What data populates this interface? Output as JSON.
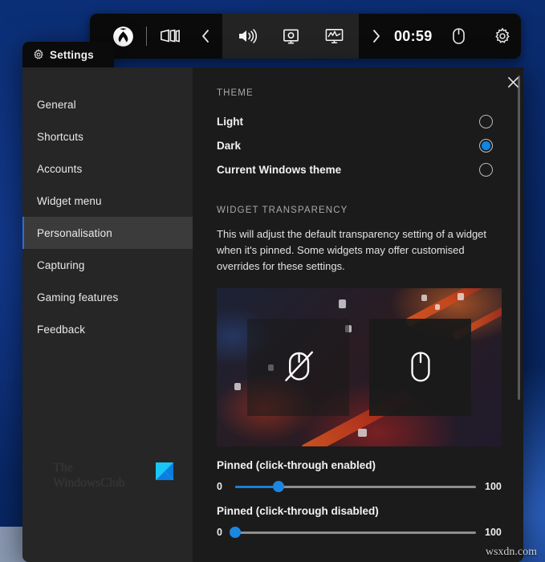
{
  "gamebar": {
    "buttons": [
      {
        "name": "xbox-logo-icon",
        "label": "Xbox"
      },
      {
        "name": "widgets-icon",
        "label": "Widgets"
      },
      {
        "name": "chevron-left-icon",
        "label": "Previous"
      },
      {
        "name": "volume-icon",
        "label": "Audio"
      },
      {
        "name": "capture-icon",
        "label": "Capture"
      },
      {
        "name": "performance-icon",
        "label": "Performance"
      },
      {
        "name": "chevron-right-icon",
        "label": "Next"
      },
      {
        "name": "mouse-icon",
        "label": "Click-through"
      },
      {
        "name": "gear-icon",
        "label": "Settings"
      }
    ],
    "clock": "00:59"
  },
  "window": {
    "title": "Settings",
    "title_icon": "gear-icon",
    "close_label": "Close"
  },
  "sidebar": {
    "items": [
      {
        "label": "General",
        "selected": false
      },
      {
        "label": "Shortcuts",
        "selected": false
      },
      {
        "label": "Accounts",
        "selected": false
      },
      {
        "label": "Widget menu",
        "selected": false
      },
      {
        "label": "Personalisation",
        "selected": true
      },
      {
        "label": "Capturing",
        "selected": false
      },
      {
        "label": "Gaming features",
        "selected": false
      },
      {
        "label": "Feedback",
        "selected": false
      }
    ],
    "watermark": {
      "line1": "The",
      "line2": "WindowsClub"
    }
  },
  "content": {
    "theme": {
      "heading": "THEME",
      "options": [
        {
          "label": "Light",
          "selected": false
        },
        {
          "label": "Dark",
          "selected": true
        },
        {
          "label": "Current Windows theme",
          "selected": false
        }
      ]
    },
    "transparency": {
      "heading": "WIDGET TRANSPARENCY",
      "description": "This will adjust the default transparency setting of a widget when it's pinned. Some widgets may offer customised overrides for these settings.",
      "preview": {
        "left_panel_icon": "mouse-click-through-disabled-icon",
        "right_panel_icon": "mouse-icon"
      },
      "sliders": [
        {
          "label": "Pinned (click-through enabled)",
          "min_label": "0",
          "max_label": "100",
          "value": 18
        },
        {
          "label": "Pinned (click-through disabled)",
          "min_label": "0",
          "max_label": "100",
          "value": 0
        }
      ]
    }
  },
  "colors": {
    "accent": "#0d86e8",
    "slider_fill": "#1a7fd4",
    "window_bg": "#1b1b1b",
    "sidebar_bg": "#262626",
    "selected_bg": "#3b3b3b"
  },
  "overlay_watermark": "wsxdn.com"
}
